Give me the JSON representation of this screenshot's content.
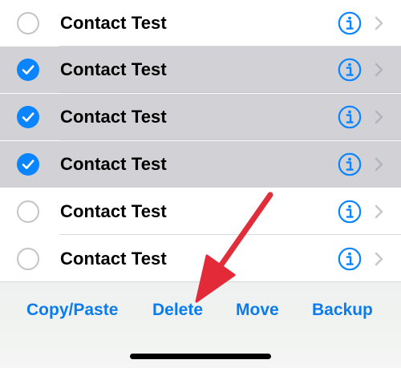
{
  "contacts": [
    {
      "name": "Contact Test",
      "selected": false
    },
    {
      "name": "Contact Test",
      "selected": true
    },
    {
      "name": "Contact Test",
      "selected": true
    },
    {
      "name": "Contact Test",
      "selected": true
    },
    {
      "name": "Contact Test",
      "selected": false
    },
    {
      "name": "Contact Test",
      "selected": false
    }
  ],
  "toolbar": {
    "copy_paste_label": "Copy/Paste",
    "delete_label": "Delete",
    "move_label": "Move",
    "backup_label": "Backup"
  },
  "icons": {
    "selection": "checkmark-circle-icon",
    "info": "info-circle-icon",
    "disclosure": "chevron-right-icon",
    "annotation": "red-arrow"
  },
  "colors": {
    "accent": "#0a84ff",
    "selected_row": "#d1d1d6",
    "annotation_arrow": "#e8313e",
    "chevron": "#c7c7cc"
  }
}
